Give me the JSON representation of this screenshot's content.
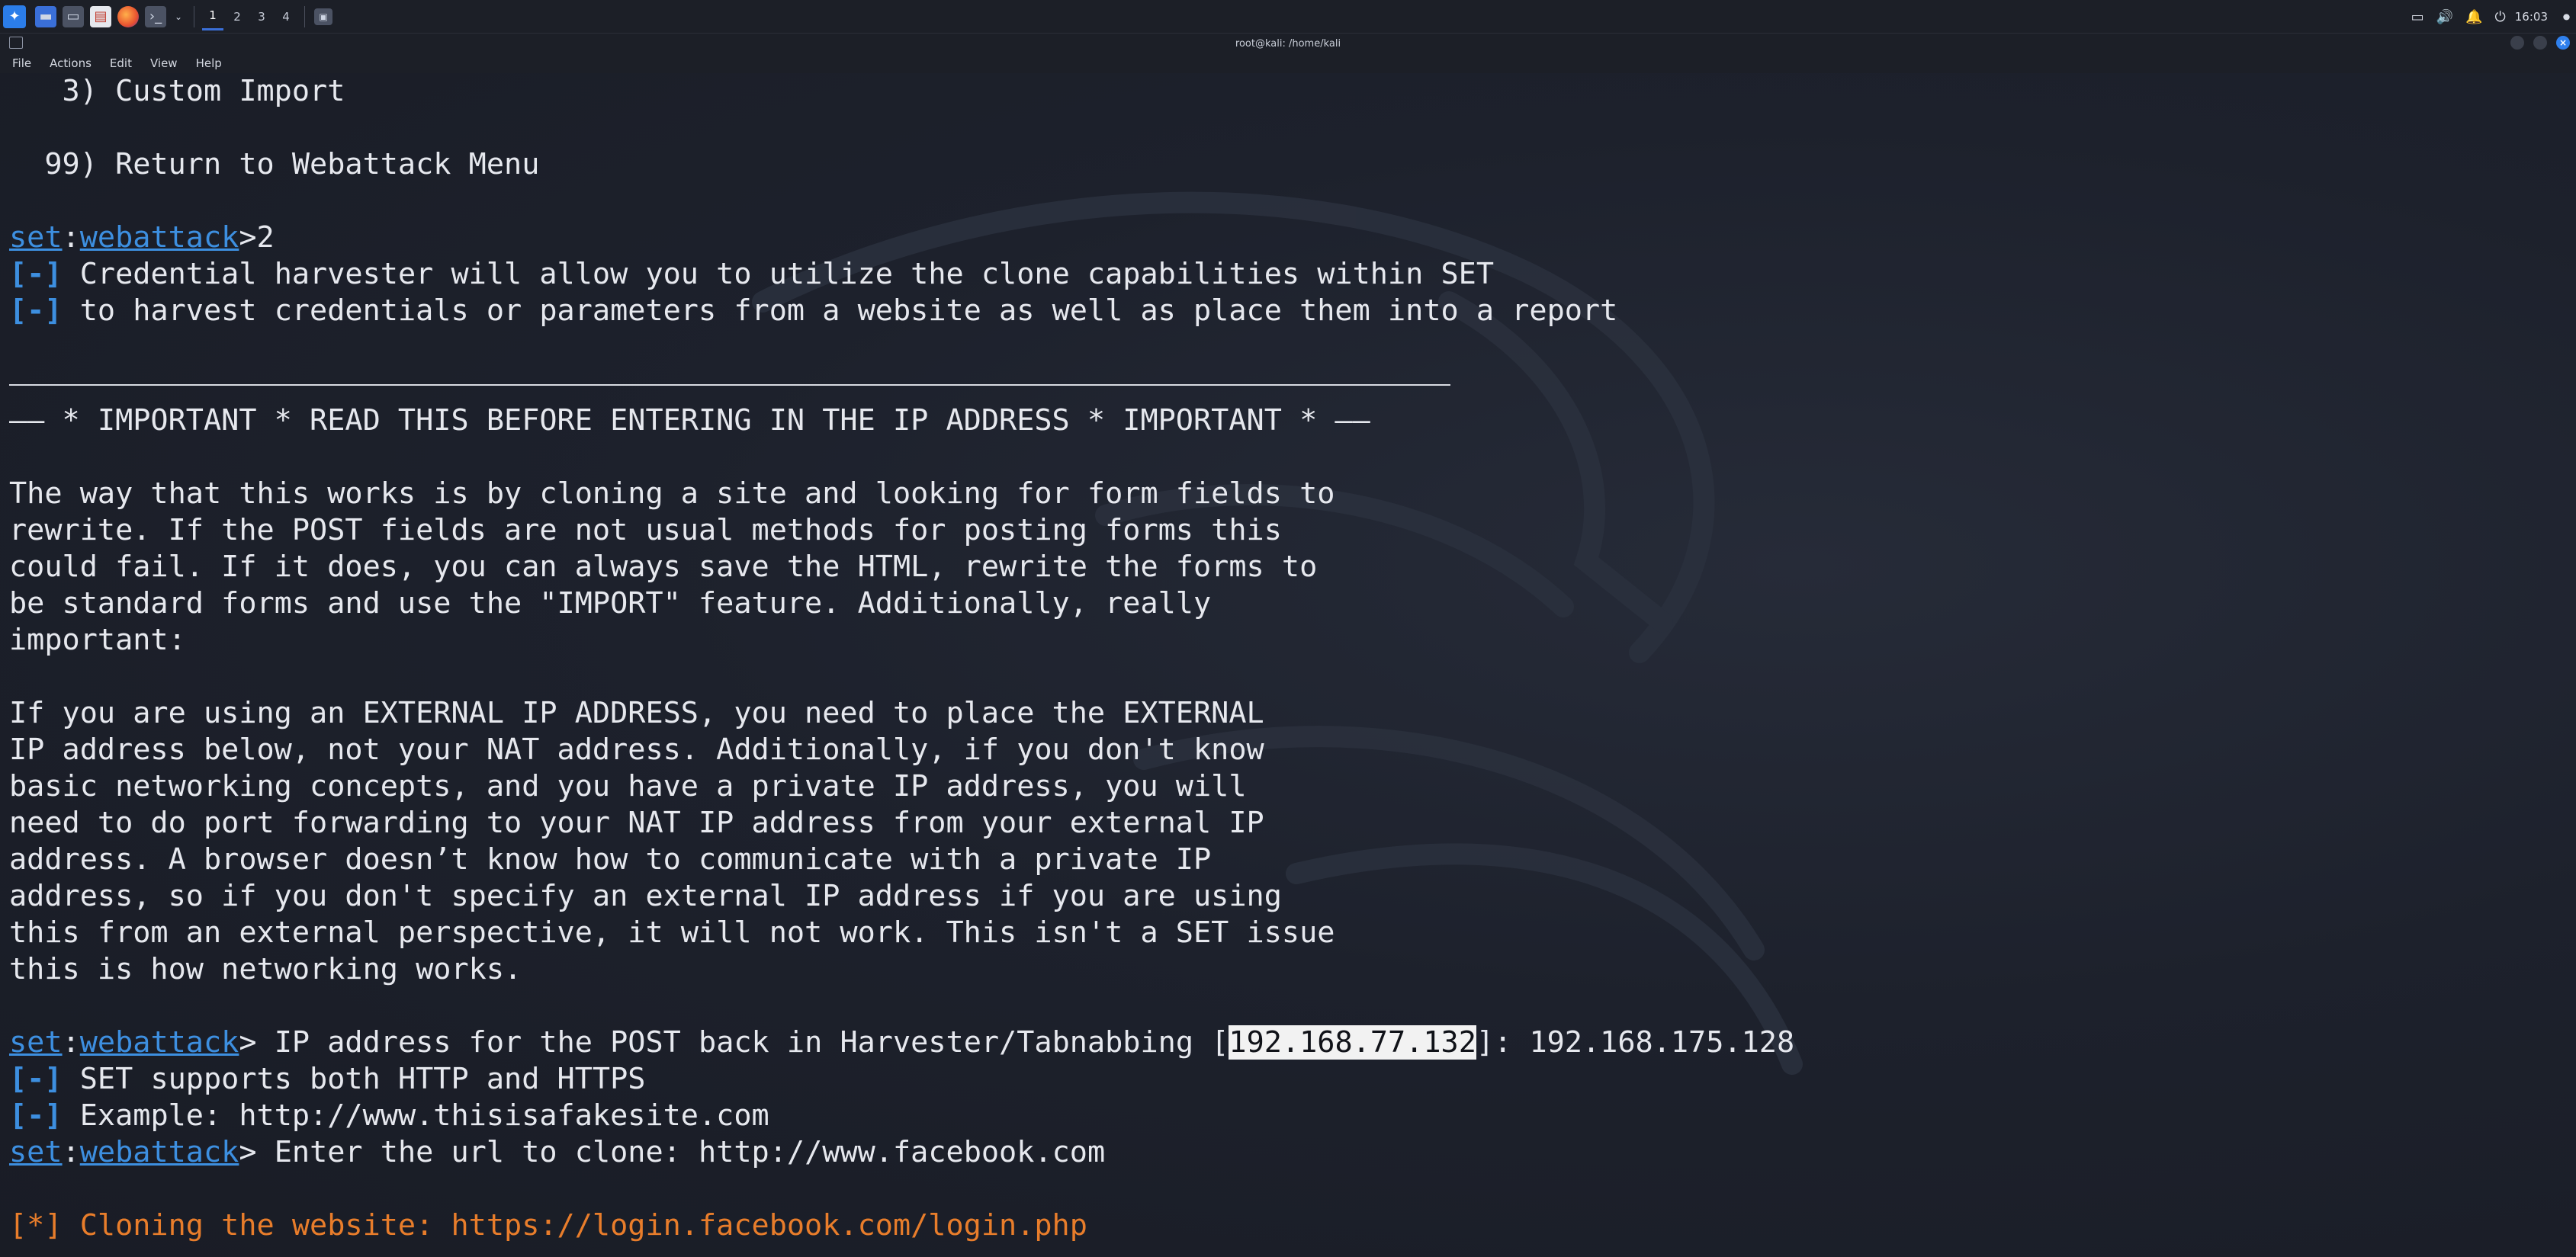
{
  "panel": {
    "launcher_icon": "kali-menu-icon",
    "apps": [
      "terminal-icon",
      "file-manager-icon",
      "text-editor-icon",
      "firefox-icon",
      "terminal-emulator-icon"
    ],
    "workspaces": [
      "1",
      "2",
      "3",
      "4"
    ],
    "tray_icons": [
      "display-icon",
      "volume-icon",
      "notification-icon",
      "power-icon"
    ],
    "clock": "16:03"
  },
  "window": {
    "title": "root@kali: /home/kali"
  },
  "menubar": {
    "items": [
      "File",
      "Actions",
      "Edit",
      "View",
      "Help"
    ]
  },
  "terminal": {
    "line_custom_import": "   3) Custom Import",
    "line_return": "  99) Return to Webattack Menu",
    "prompt_set": "set",
    "prompt_colon": ":",
    "prompt_module": "webattack",
    "cmd1_input": ">2",
    "info_bracket": "[-]",
    "info1": " Credential harvester will allow you to utilize the clone capabilities within SET",
    "info2": " to harvest credentials or parameters from a website as well as place them into a report",
    "important_banner": "—— * IMPORTANT * READ THIS BEFORE ENTERING IN THE IP ADDRESS * IMPORTANT * ——",
    "para1": [
      "The way that this works is by cloning a site and looking for form fields to",
      "rewrite. If the POST fields are not usual methods for posting forms this",
      "could fail. If it does, you can always save the HTML, rewrite the forms to",
      "be standard forms and use the \"IMPORT\" feature. Additionally, really",
      "important:"
    ],
    "para2": [
      "If you are using an EXTERNAL IP ADDRESS, you need to place the EXTERNAL",
      "IP address below, not your NAT address. Additionally, if you don't know",
      "basic networking concepts, and you have a private IP address, you will",
      "need to do port forwarding to your NAT IP address from your external IP",
      "address. A browser doesn’t know how to communicate with a private IP",
      "address, so if you don't specify an external IP address if you are using",
      "this from an external perspective, it will not work. This isn't a SET issue",
      "this is how networking works."
    ],
    "ip_prompt_pre": "> IP address for the POST back in Harvester/Tabnabbing [",
    "ip_default": "192.168.77.132",
    "ip_prompt_post": "]: 192.168.175.128",
    "info3": " SET supports both HTTP and HTTPS",
    "info4": " Example: http://www.thisisafakesite.com",
    "url_prompt": "> Enter the url to clone: http://www.facebook.com",
    "cloning": "[*] Cloning the website: https://login.facebook.com/login.php"
  }
}
